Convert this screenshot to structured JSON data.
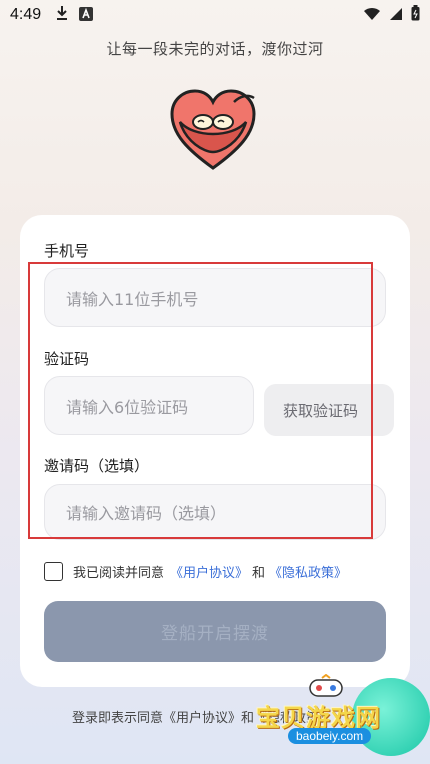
{
  "status_bar": {
    "time": "4:49",
    "icons": [
      "download-icon",
      "a-badge-icon",
      "wifi-icon",
      "cellular-icon",
      "battery-icon"
    ]
  },
  "tagline": "让每一段未完的对话，渡你过河",
  "form": {
    "phone": {
      "label": "手机号",
      "placeholder": "请输入11位手机号"
    },
    "code": {
      "label": "验证码",
      "placeholder": "请输入6位验证码",
      "button_label": "获取验证码"
    },
    "invite": {
      "label": "邀请码（选填）",
      "placeholder": "请输入邀请码（选填）"
    },
    "agreement": {
      "prefix": "我已阅读并同意",
      "user_agreement": "《用户协议》",
      "and": "和",
      "privacy_policy": "《隐私政策》",
      "checked": false
    },
    "submit_label": "登船开启摆渡"
  },
  "bottom_note": "登录即表示同意《用户协议》和《隐私政策》",
  "watermark": {
    "title": "宝贝游戏网",
    "url": "baobeiy.com"
  },
  "colors": {
    "accent_link": "#3b6fd8",
    "logo_heart": "#f0756b",
    "submit_disabled": "#8b97ad",
    "highlight_box": "#d83a3a"
  }
}
